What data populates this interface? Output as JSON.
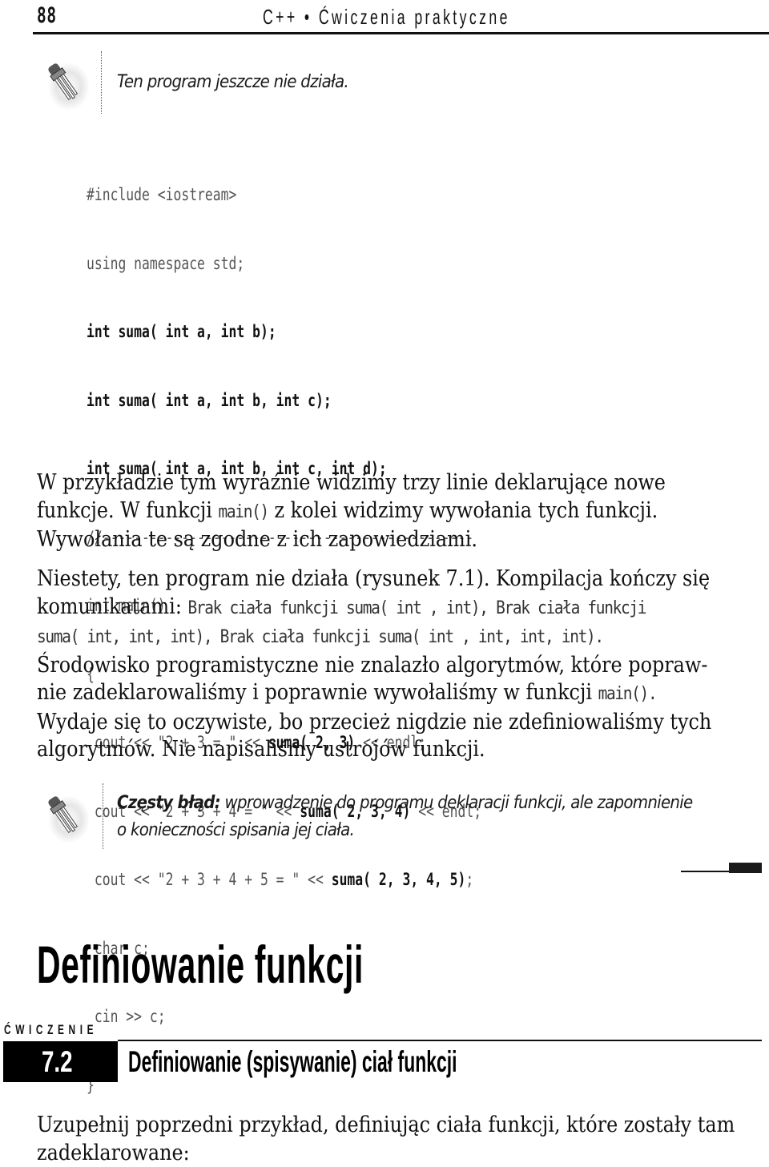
{
  "header": {
    "page_number": "88",
    "running_title": "C++ • Ćwiczenia praktyczne"
  },
  "note1": {
    "icon": "lightbulb-icon",
    "text": "Ten program jeszcze nie działa."
  },
  "code": {
    "lines": [
      {
        "text": "#include <iostream>",
        "style": "thin"
      },
      {
        "text": "using namespace std;",
        "style": "thin"
      },
      {
        "text": "int suma( int a, int b);",
        "style": "bold"
      },
      {
        "text": "int suma( int a, int b, int c);",
        "style": "bold"
      },
      {
        "text": "int suma( int a, int b, int c, int d);",
        "style": "bold"
      },
      {
        "text": "//-----------------------------------------------",
        "style": "thin"
      },
      {
        "text": "int main()",
        "style": "thin"
      },
      {
        "text": "{",
        "style": "thin"
      },
      {
        "pre": " cout << \"2 + 3 = \" << ",
        "call": "suma( 2, 3)",
        "post": " << endl;"
      },
      {
        "pre": " cout << \"2 + 3 + 4 = \" << ",
        "call": "suma( 2, 3, 4)",
        "post": " << endl;"
      },
      {
        "pre": " cout << \"2 + 3 + 4 + 5 = \" << ",
        "call": "suma( 2, 3, 4, 5)",
        "post": ";"
      },
      {
        "text": " char c;",
        "style": "thin"
      },
      {
        "text": " cin >> c;",
        "style": "thin"
      },
      {
        "text": "}",
        "style": "thin"
      }
    ]
  },
  "paragraph1": {
    "l1": "W przykładzie tym wyraźnie widzimy trzy linie deklarujące nowe",
    "l2_a": "funkcje. W funkcji ",
    "l2_code": "main()",
    "l2_b": " z kolei widzimy wywołania tych funkcji.",
    "l3": "Wywołania te są zgodne z ich zapowiedziami."
  },
  "paragraph2": {
    "l1": "Niestety, ten program nie działa (rysunek 7.1). Kompilacja kończy się",
    "l2_a": "komunikatami: ",
    "l2_code": "Brak ciała funkcji suma( int , int), Brak ciała funkcji",
    "l3_code": "suma( int, int, int), Brak ciała funkcji suma( int , int, int, int).",
    "l4": "Środowisko programistyczne nie znalazło algorytmów, które popraw-",
    "l5_a": "nie zadeklarowaliśmy i poprawnie wywołaliśmy w funkcji ",
    "l5_code": "main().",
    "l6": "Wydaje się to oczywiste, bo przecież nigdzie nie zdefiniowaliśmy tych",
    "l7": "algorytmów. Nie napisaliśmy ustrojów funkcji."
  },
  "note2": {
    "icon": "lightbulb-icon",
    "label": "Częsty błąd:",
    "text_l1": " wprowadzenie do programu deklaracji funkcji, ale zapomnienie",
    "text_l2": "o konieczności spisania jej ciała."
  },
  "section": {
    "heading": "Definiowanie funkcji"
  },
  "exercise": {
    "label": "ĆWICZENIE",
    "number": "7.2",
    "title": "Definiowanie (spisywanie) ciał funkcji",
    "intro_l1": "Uzupełnij poprzedni przykład, definiując ciała funkcji, które zostały tam",
    "intro_l2": "zadeklarowane:"
  }
}
